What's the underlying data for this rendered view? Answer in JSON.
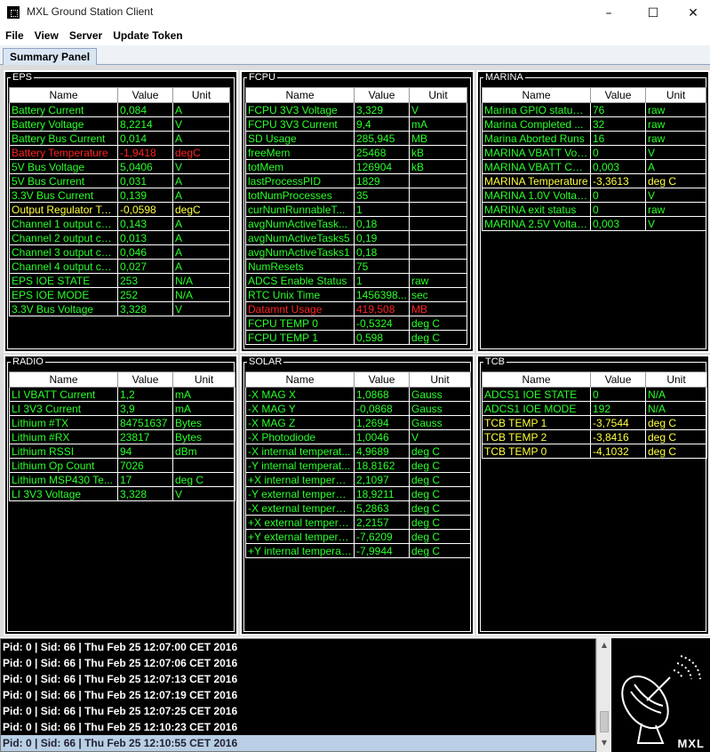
{
  "window": {
    "title": "MXL Ground Station Client",
    "minimize": "–",
    "maximize": "☐",
    "close": "✕"
  },
  "menu": [
    "File",
    "View",
    "Server",
    "Update Token"
  ],
  "tabs": [
    {
      "label": "Summary Panel"
    }
  ],
  "headers": {
    "name": "Name",
    "value": "Value",
    "unit": "Unit"
  },
  "panels": {
    "eps": {
      "title": "EPS",
      "rows": [
        {
          "name": "Battery Current",
          "value": "0,084",
          "unit": "A",
          "status": "ok"
        },
        {
          "name": "Battery Voltage",
          "value": "8,2214",
          "unit": "V",
          "status": "ok"
        },
        {
          "name": "Battery Bus Current",
          "value": "0,014",
          "unit": "A",
          "status": "ok"
        },
        {
          "name": "Battery Temperature",
          "value": "-1,9418",
          "unit": "degC",
          "status": "alert"
        },
        {
          "name": "5V Bus Voltage",
          "value": "5,0406",
          "unit": "V",
          "status": "ok"
        },
        {
          "name": "5V Bus Current",
          "value": "0,031",
          "unit": "A",
          "status": "ok"
        },
        {
          "name": "3.3V Bus Current",
          "value": "0,139",
          "unit": "A",
          "status": "ok"
        },
        {
          "name": "Output Regulator Te...",
          "value": "-0,0598",
          "unit": "degC",
          "status": "warn"
        },
        {
          "name": "Channel 1 output cu...",
          "value": "0,143",
          "unit": "A",
          "status": "ok"
        },
        {
          "name": "Channel 2 output cu...",
          "value": "0,013",
          "unit": "A",
          "status": "ok"
        },
        {
          "name": "Channel 3 output cu...",
          "value": "0,046",
          "unit": "A",
          "status": "ok"
        },
        {
          "name": "Channel 4 output cu...",
          "value": "0,027",
          "unit": "A",
          "status": "ok"
        },
        {
          "name": "EPS IOE STATE",
          "value": "253",
          "unit": "N/A",
          "status": "ok"
        },
        {
          "name": "EPS IOE MODE",
          "value": "252",
          "unit": "N/A",
          "status": "ok"
        },
        {
          "name": "3.3V Bus Voltage",
          "value": "3,328",
          "unit": "V",
          "status": "ok"
        }
      ]
    },
    "fcpu": {
      "title": "FCPU",
      "rows": [
        {
          "name": "FCPU 3V3 Voltage",
          "value": "3,329",
          "unit": "V",
          "status": "ok"
        },
        {
          "name": "FCPU 3V3 Current",
          "value": "9,4",
          "unit": "mA",
          "status": "ok"
        },
        {
          "name": "SD Usage",
          "value": "285,945",
          "unit": "MB",
          "status": "ok"
        },
        {
          "name": "freeMem",
          "value": "25468",
          "unit": "kB",
          "status": "ok"
        },
        {
          "name": "totMem",
          "value": "126904",
          "unit": "kB",
          "status": "ok"
        },
        {
          "name": "lastProcessPID",
          "value": "1829",
          "unit": "",
          "status": "ok"
        },
        {
          "name": "totNumProcesses",
          "value": "35",
          "unit": "",
          "status": "ok"
        },
        {
          "name": "curNumRunnableT...",
          "value": "1",
          "unit": "",
          "status": "ok"
        },
        {
          "name": "avgNumActiveTask...",
          "value": "0,18",
          "unit": "",
          "status": "ok"
        },
        {
          "name": "avgNumActiveTasks5",
          "value": "0,19",
          "unit": "",
          "status": "ok"
        },
        {
          "name": "avgNumActiveTasks1",
          "value": "0,18",
          "unit": "",
          "status": "ok"
        },
        {
          "name": "NumResets",
          "value": "75",
          "unit": "",
          "status": "ok"
        },
        {
          "name": "ADCS Enable Status",
          "value": "1",
          "unit": "raw",
          "status": "ok"
        },
        {
          "name": "RTC Unix Time",
          "value": "1456398...",
          "unit": "sec",
          "status": "ok"
        },
        {
          "name": "Datamnt Usage",
          "value": "419,508",
          "unit": "MB",
          "status": "alert"
        },
        {
          "name": "FCPU TEMP 0",
          "value": "-0,5324",
          "unit": "deg C",
          "status": "ok"
        },
        {
          "name": "FCPU TEMP 1",
          "value": "0,598",
          "unit": "deg C",
          "status": "ok"
        }
      ]
    },
    "marina": {
      "title": "MARINA",
      "rows": [
        {
          "name": "Marina GPIO status ...",
          "value": "76",
          "unit": "raw",
          "status": "ok"
        },
        {
          "name": "Marina Completed ...",
          "value": "32",
          "unit": "raw",
          "status": "ok"
        },
        {
          "name": "Marina Aborted Runs",
          "value": "16",
          "unit": "raw",
          "status": "ok"
        },
        {
          "name": "MARINA VBATT Volt...",
          "value": "0",
          "unit": "V",
          "status": "ok"
        },
        {
          "name": "MARINA VBATT Curr...",
          "value": "0,003",
          "unit": "A",
          "status": "ok"
        },
        {
          "name": "MARINA Temperature",
          "value": "-3,3613",
          "unit": "deg C",
          "status": "warn"
        },
        {
          "name": "MARINA 1.0V Voltage",
          "value": "0",
          "unit": "V",
          "status": "ok"
        },
        {
          "name": "MARINA exit status",
          "value": "0",
          "unit": "raw",
          "status": "ok"
        },
        {
          "name": "MARINA 2.5V Voltage",
          "value": "0,003",
          "unit": "V",
          "status": "ok"
        }
      ]
    },
    "radio": {
      "title": "RADIO",
      "rows": [
        {
          "name": "LI VBATT Current",
          "value": "1,2",
          "unit": "mA",
          "status": "ok"
        },
        {
          "name": "LI 3V3 Current",
          "value": "3,9",
          "unit": "mA",
          "status": "ok"
        },
        {
          "name": "Lithium #TX",
          "value": "84751637",
          "unit": "Bytes",
          "status": "ok"
        },
        {
          "name": "Lithium #RX",
          "value": "23817",
          "unit": "Bytes",
          "status": "ok"
        },
        {
          "name": "Lithium RSSI",
          "value": "94",
          "unit": "dBm",
          "status": "ok"
        },
        {
          "name": "Lithium Op Count",
          "value": "7026",
          "unit": "",
          "status": "ok"
        },
        {
          "name": "Lithium MSP430 Te...",
          "value": "17",
          "unit": "deg C",
          "status": "ok"
        },
        {
          "name": "LI 3V3 Voltage",
          "value": "3,328",
          "unit": "V",
          "status": "ok"
        }
      ]
    },
    "solar": {
      "title": "SOLAR",
      "rows": [
        {
          "name": "-X MAG X",
          "value": "1,0868",
          "unit": "Gauss",
          "status": "ok"
        },
        {
          "name": "-X MAG Y",
          "value": "-0,0868",
          "unit": "Gauss",
          "status": "ok"
        },
        {
          "name": "-X MAG Z",
          "value": "1,2694",
          "unit": "Gauss",
          "status": "ok"
        },
        {
          "name": "-X Photodiode",
          "value": "1,0046",
          "unit": "V",
          "status": "ok"
        },
        {
          "name": "-X internal temperat...",
          "value": "4,9689",
          "unit": "deg C",
          "status": "ok"
        },
        {
          "name": "-Y internal temperat...",
          "value": "18,8162",
          "unit": "deg C",
          "status": "ok"
        },
        {
          "name": "+X internal temperat...",
          "value": "2,1097",
          "unit": "deg C",
          "status": "ok"
        },
        {
          "name": "-Y external temperat...",
          "value": "18,9211",
          "unit": "deg C",
          "status": "ok"
        },
        {
          "name": "-X external temperat...",
          "value": "5,2863",
          "unit": "deg C",
          "status": "ok"
        },
        {
          "name": "+X external tempera...",
          "value": "2,2157",
          "unit": "deg C",
          "status": "ok"
        },
        {
          "name": "+Y external tempera...",
          "value": "-7,6209",
          "unit": "deg C",
          "status": "ok"
        },
        {
          "name": "+Y internal temperat...",
          "value": "-7,9944",
          "unit": "deg C",
          "status": "ok"
        }
      ]
    },
    "tcb": {
      "title": "TCB",
      "rows": [
        {
          "name": "ADCS1 IOE STATE",
          "value": "0",
          "unit": "N/A",
          "status": "ok"
        },
        {
          "name": "ADCS1 IOE MODE",
          "value": "192",
          "unit": "N/A",
          "status": "ok"
        },
        {
          "name": "TCB TEMP 1",
          "value": "-3,7544",
          "unit": "deg C",
          "status": "warn"
        },
        {
          "name": "TCB TEMP 2",
          "value": "-3,8416",
          "unit": "deg C",
          "status": "warn"
        },
        {
          "name": "TCB TEMP 0",
          "value": "-4,1032",
          "unit": "deg C",
          "status": "warn"
        }
      ]
    }
  },
  "log": [
    "Pid: 0 | Sid: 66 | Thu Feb 25 12:07:00 CET 2016",
    "Pid: 0 | Sid: 66 | Thu Feb 25 12:07:06 CET 2016",
    "Pid: 0 | Sid: 66 | Thu Feb 25 12:07:13 CET 2016",
    "Pid: 0 | Sid: 66 | Thu Feb 25 12:07:19 CET 2016",
    "Pid: 0 | Sid: 66 | Thu Feb 25 12:07:25 CET 2016",
    "Pid: 0 | Sid: 66 | Thu Feb 25 12:10:23 CET 2016",
    "Pid: 0 | Sid: 66 | Thu Feb 25 12:10:55 CET 2016"
  ],
  "log_selected_index": 6,
  "logo": {
    "text": "MXL",
    "icon": "satellite-dish-icon"
  },
  "colors": {
    "ok": "#29ff29",
    "warn": "#ffff3c",
    "alert": "#ff2222",
    "background": "#000000"
  }
}
